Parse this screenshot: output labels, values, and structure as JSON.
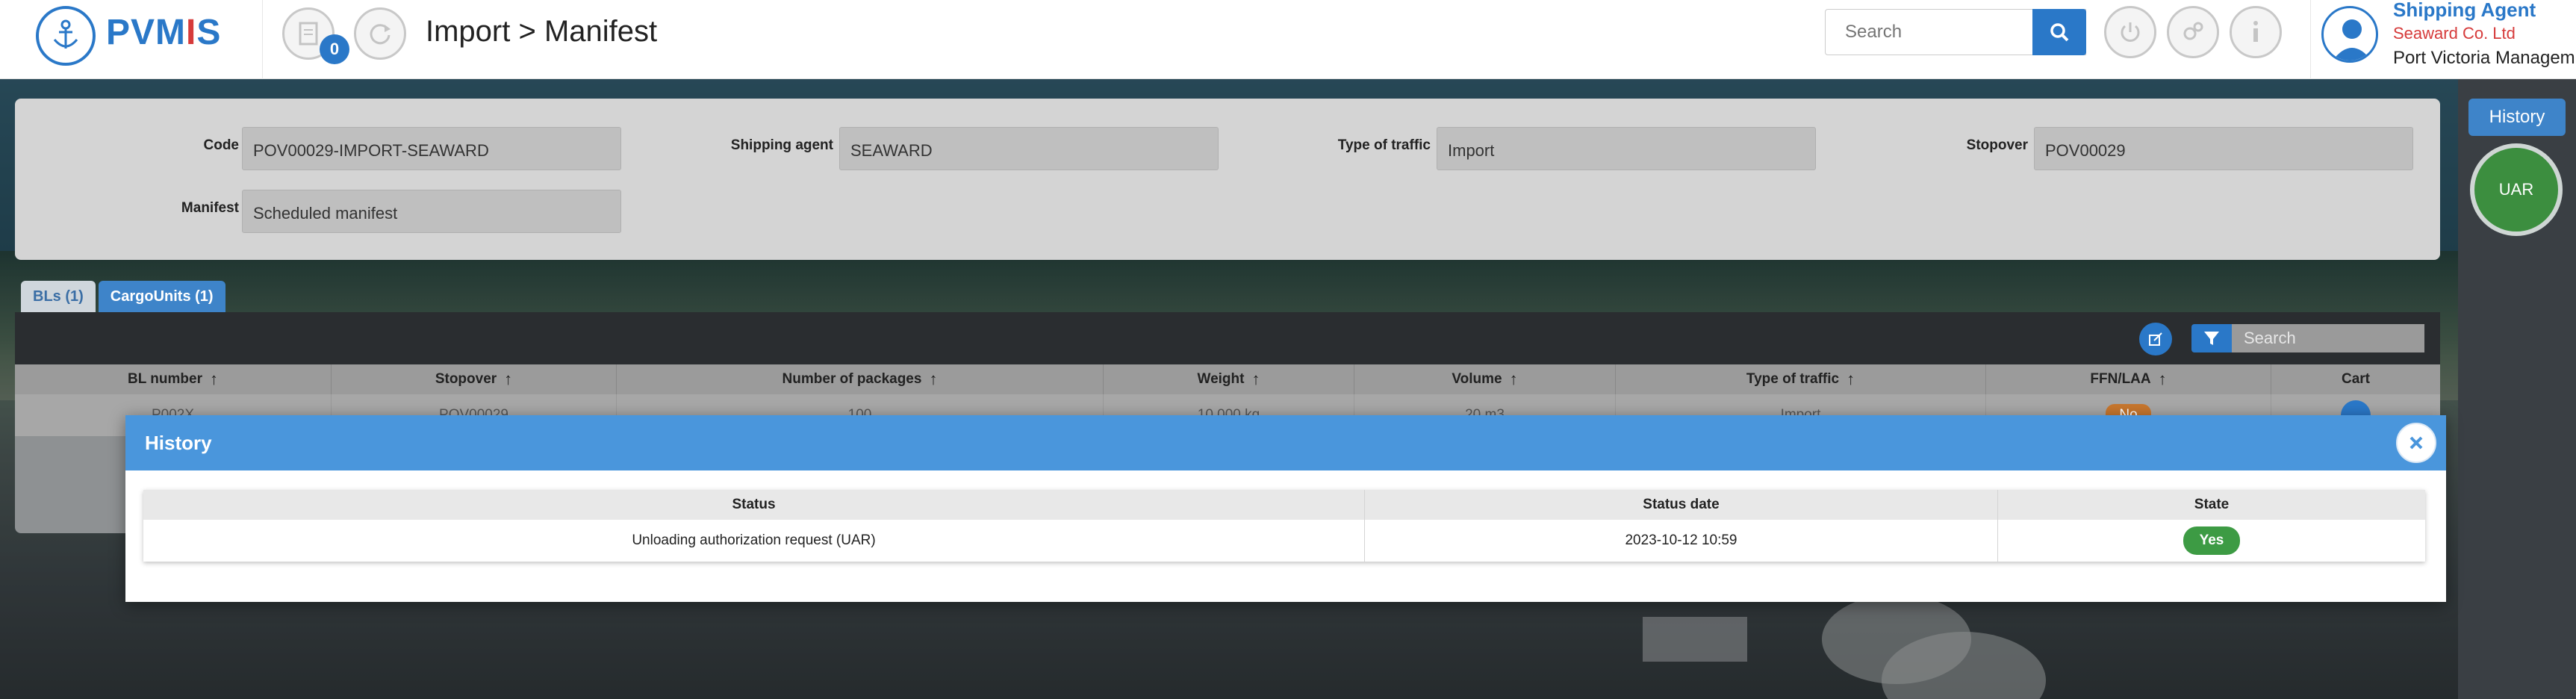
{
  "header": {
    "logo_text_prefix": "PVM",
    "logo_text_accent": "I",
    "logo_text_suffix": "S",
    "notification_count": "0",
    "breadcrumb": "Import > Manifest",
    "search_placeholder": "Search"
  },
  "user": {
    "role": "Shipping Agent",
    "company": "Seaward Co. Ltd",
    "organization": "Port Victoria Managem"
  },
  "form": {
    "code_label": "Code",
    "code_value": "POV00029-IMPORT-SEAWARD",
    "shipping_agent_label": "Shipping agent",
    "shipping_agent_value": "SEAWARD",
    "type_of_traffic_label": "Type of traffic",
    "type_of_traffic_value": "Import",
    "stopover_label": "Stopover",
    "stopover_value": "POV00029",
    "manifest_label": "Manifest",
    "manifest_value": "Scheduled manifest"
  },
  "tabs": [
    {
      "label": "BLs (1)"
    },
    {
      "label": "CargoUnits (1)"
    }
  ],
  "table": {
    "search_placeholder": "Search",
    "columns": [
      "BL number",
      "Stopover",
      "Number of packages",
      "Weight",
      "Volume",
      "Type of traffic",
      "FFN/LAA",
      "Cart"
    ],
    "row": [
      "P002X",
      "POV00029",
      "100",
      "10 000 kg",
      "20 m3",
      "Import",
      "No",
      ""
    ]
  },
  "right_panel": {
    "history_label": "History",
    "status_badge": "UAR"
  },
  "modal": {
    "title": "History",
    "columns": [
      "Status",
      "Status date",
      "State"
    ],
    "rows": [
      {
        "status": "Unloading authorization request (UAR)",
        "date": "2023-10-12 10:59",
        "state": "Yes"
      }
    ]
  },
  "colors": {
    "brand_blue": "#2a78c8",
    "brand_red": "#d63b3b",
    "success_green": "#3d9b44",
    "modal_header": "#4a96dc"
  }
}
